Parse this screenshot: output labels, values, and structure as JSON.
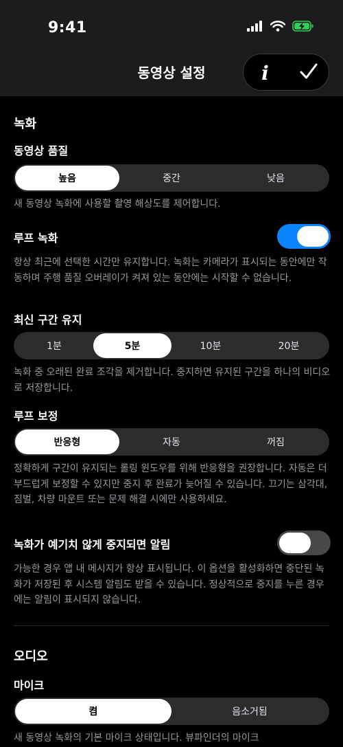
{
  "status": {
    "time": "9:41"
  },
  "nav": {
    "title": "동영상 설정",
    "info_label": "i"
  },
  "recording": {
    "section_title": "녹화",
    "quality": {
      "label": "동영상 품질",
      "options": [
        "높음",
        "중간",
        "낮음"
      ],
      "selected": "높음",
      "description": "새 동영상 녹화에 사용할 촬영 해상도를 제어합니다."
    },
    "loop": {
      "label": "루프 녹화",
      "enabled": true,
      "description": "항상 최근에 선택한 시간만 유지합니다. 녹화는 카메라가 표시되는 동안에만 작동하며 주행 품질 오버레이가 켜져 있는 동안에는 시작할 수 없습니다."
    },
    "keep": {
      "label": "최신 구간 유지",
      "options": [
        "1분",
        "5분",
        "10분",
        "20분"
      ],
      "selected": "5분",
      "description": "녹화 중 오래된 완료 조각을 제거합니다. 중지하면 유지된 구간을 하나의 비디오로 저장합니다."
    },
    "stabilization": {
      "label": "루프 보정",
      "options": [
        "반응형",
        "자동",
        "꺼짐"
      ],
      "selected": "반응형",
      "description": "정확하게 구간이 유지되는 롤링 윈도우를 위해 반응형을 권장합니다. 자동은 더 부드럽게 보정할 수 있지만 중지 후 완료가 늦어질 수 있습니다. 끄기는 삼각대, 짐벌, 차량 마운트 또는 문제 해결 시에만 사용하세요."
    },
    "alert": {
      "label": "녹화가 예기치 않게 중지되면 알림",
      "enabled": false,
      "description": "가능한 경우 앱 내 메시지가 항상 표시됩니다. 이 옵션을 활성화하면 중단된 녹화가 저장된 후 시스템 알림도 받을 수 있습니다. 정상적으로 중지를 누른 경우에는 알림이 표시되지 않습니다."
    }
  },
  "audio": {
    "section_title": "오디오",
    "mic": {
      "label": "마이크",
      "options": [
        "켬",
        "음소거됨"
      ],
      "selected": "켬",
      "description": "새 동영상 녹화의 기본 마이크 상태입니다. 뷰파인더의 마이크"
    }
  },
  "colors": {
    "accent": "#0a84ff",
    "battery": "#30d158",
    "background": "#000000",
    "header": "#1c1c1e"
  }
}
